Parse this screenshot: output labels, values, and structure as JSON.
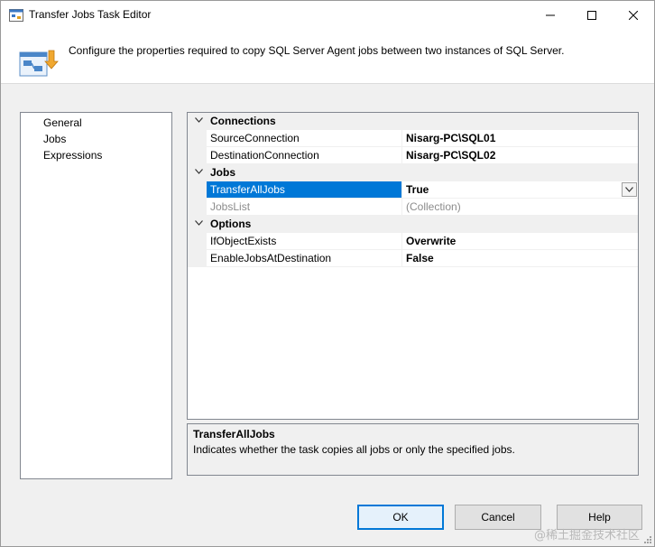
{
  "window": {
    "title": "Transfer Jobs Task Editor",
    "minimize": "—",
    "maximize": "☐",
    "close": "✕"
  },
  "header": {
    "description": "Configure the properties required to copy SQL Server Agent jobs between two instances of SQL Server."
  },
  "nav": {
    "items": [
      {
        "label": "General"
      },
      {
        "label": "Jobs"
      },
      {
        "label": "Expressions"
      }
    ],
    "selected": "Jobs"
  },
  "properties": {
    "categories": [
      {
        "label": "Connections",
        "rows": [
          {
            "name": "SourceConnection",
            "value": "Nisarg-PC\\SQL01"
          },
          {
            "name": "DestinationConnection",
            "value": "Nisarg-PC\\SQL02"
          }
        ]
      },
      {
        "label": "Jobs",
        "rows": [
          {
            "name": "TransferAllJobs",
            "value": "True"
          },
          {
            "name": "JobsList",
            "value": "(Collection)"
          }
        ]
      },
      {
        "label": "Options",
        "rows": [
          {
            "name": "IfObjectExists",
            "value": "Overwrite"
          },
          {
            "name": "EnableJobsAtDestination",
            "value": "False"
          }
        ]
      }
    ],
    "selected_row": "TransferAllJobs"
  },
  "description": {
    "title": "TransferAllJobs",
    "text": "Indicates whether the task copies all jobs or only the specified jobs."
  },
  "buttons": {
    "ok": "OK",
    "cancel": "Cancel",
    "help": "Help"
  },
  "watermark": "@稀土掘金技术社区",
  "colors": {
    "selection": "#0078d7",
    "category_bg": "#f0f0f0",
    "disabled_text": "#8c8c8c"
  }
}
